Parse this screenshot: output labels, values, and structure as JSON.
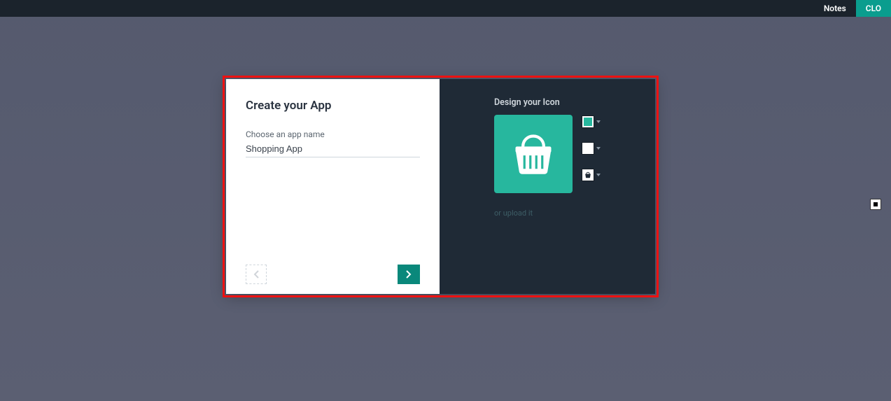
{
  "topbar": {
    "notes_label": "Notes",
    "close_label": "CLO"
  },
  "modal": {
    "title": "Create your App",
    "name_field": {
      "label": "Choose an app name",
      "value": "Shopping App"
    }
  },
  "design": {
    "label": "Design your Icon",
    "upload_link": "or upload it",
    "colors": {
      "background": "#27b79e",
      "foreground": "#ffffff"
    }
  }
}
